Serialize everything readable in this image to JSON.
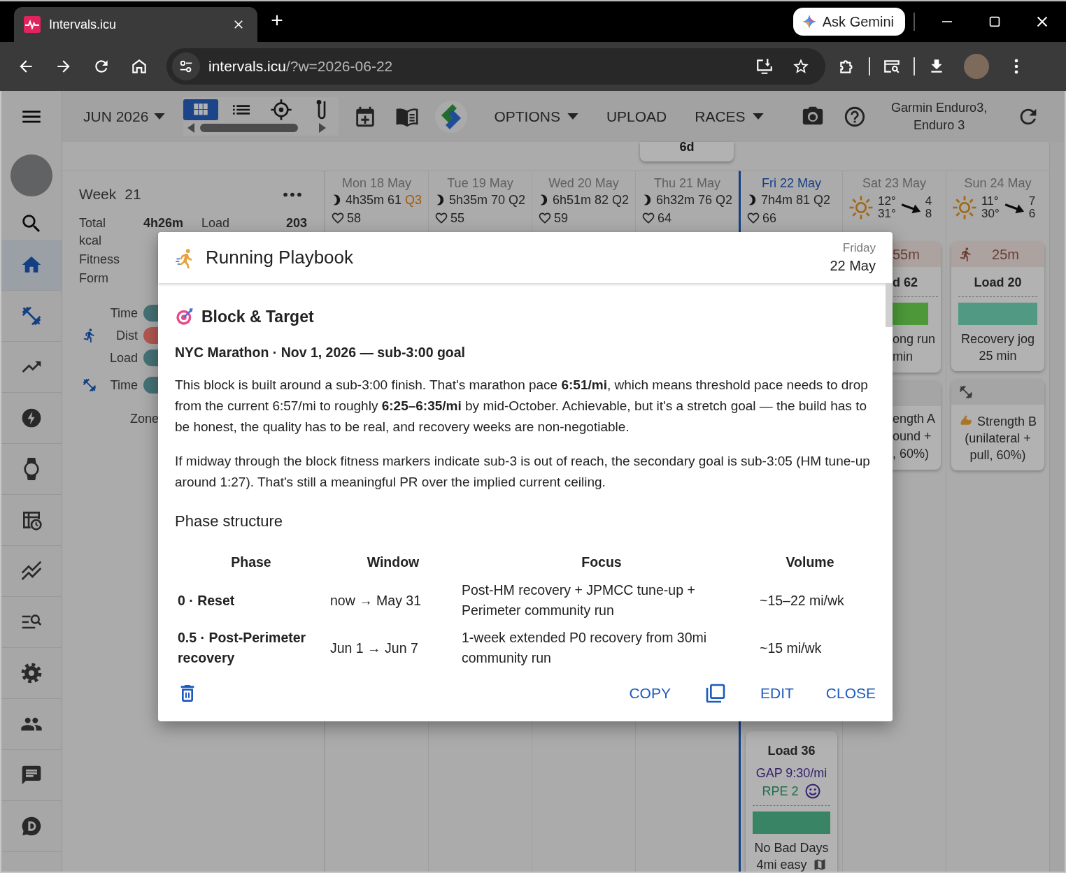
{
  "browser": {
    "tab_title": "Intervals.icu",
    "gemini_label": "Ask Gemini",
    "url_host": "intervals.icu",
    "url_path": "/?w=2026-06-22"
  },
  "nav": {
    "items": [
      {
        "kind": "home",
        "selected": true
      },
      {
        "kind": "dumbbell",
        "selected": false
      },
      {
        "kind": "trend",
        "selected": false
      },
      {
        "kind": "bolt",
        "selected": false
      },
      {
        "kind": "watch",
        "selected": false
      },
      {
        "kind": "calendar-clock",
        "selected": false
      },
      {
        "kind": "multiline",
        "selected": false
      },
      {
        "kind": "list-search",
        "selected": false
      },
      {
        "kind": "gear",
        "selected": false
      },
      {
        "kind": "people",
        "selected": false
      },
      {
        "kind": "chat",
        "selected": false
      },
      {
        "kind": "discord",
        "selected": false
      }
    ]
  },
  "toolbar": {
    "month": "JUN 2026",
    "views": [
      {
        "kind": "grid",
        "selected": true
      },
      {
        "kind": "list",
        "selected": false
      },
      {
        "kind": "target",
        "selected": false
      },
      {
        "kind": "pin",
        "selected": false
      }
    ],
    "menus": [
      {
        "label": "OPTIONS",
        "dropdown": true
      },
      {
        "label": "UPLOAD",
        "dropdown": false
      },
      {
        "label": "RACES",
        "dropdown": true
      }
    ],
    "device": "Garmin Enduro3, Enduro 3"
  },
  "calendar": {
    "pinned_tab": "6d",
    "week": {
      "label": "Week",
      "number": "21",
      "total": {
        "label": "Total",
        "value": "4h26m"
      },
      "load": {
        "label": "Load",
        "value": "203"
      },
      "metrics": [
        "kcal",
        "Fitness",
        "Form"
      ],
      "bars": [
        {
          "kind": "plain",
          "label": "Time",
          "color": "#457377"
        },
        {
          "kind": "run",
          "label": "Dist",
          "color": "#b25852"
        },
        {
          "kind": "plain",
          "label": "Load",
          "color": "#457377"
        },
        {
          "kind": "strength",
          "label": "Time",
          "color": "#457377"
        }
      ],
      "zones_label": "Zone"
    },
    "days": [
      {
        "date": "Mon 18 May",
        "today": false,
        "kind": "summary",
        "duration": "4h35m",
        "load": "61",
        "quality": "Q3",
        "quality_warning": true,
        "hr": "58"
      },
      {
        "date": "Tue 19 May",
        "today": false,
        "kind": "summary",
        "duration": "5h35m",
        "load": "70",
        "quality": "Q2",
        "quality_warning": false,
        "hr": "55"
      },
      {
        "date": "Wed 20 May",
        "today": false,
        "kind": "summary",
        "duration": "6h51m",
        "load": "82",
        "quality": "Q2",
        "quality_warning": false,
        "hr": "59"
      },
      {
        "date": "Thu 21 May",
        "today": false,
        "kind": "summary",
        "duration": "6h32m",
        "load": "76",
        "quality": "Q2",
        "quality_warning": false,
        "hr": "64"
      },
      {
        "date": "Fri 22 May",
        "today": true,
        "kind": "summary",
        "duration": "7h4m",
        "load": "81",
        "quality": "Q2",
        "quality_warning": false,
        "hr": "66",
        "cards": [
          {
            "kind": "run",
            "clipped_top": true,
            "clipped_left": false,
            "load": "Load 36",
            "pace": "GAP 9:30/mi",
            "rpe": "RPE 2",
            "color": "#3a8466",
            "text": "No Bad Days 4mi easy",
            "route": true
          }
        ]
      },
      {
        "date": "Sat 23 May",
        "today": false,
        "kind": "weather",
        "temp_1": "12°",
        "temp_2": "31°",
        "wind_1": "4",
        "wind_2": "8",
        "cards": [
          {
            "kind": "run",
            "clipped_top": false,
            "clipped_left": true,
            "duration": "55m",
            "load": "d 62",
            "color": "#4e9a3a",
            "lines": [
              "ong run",
              "min"
            ]
          },
          {
            "kind": "strength",
            "clipped_top": false,
            "clipped_left": true,
            "lines": [
              "ength A",
              "ound +",
              ", 60%)"
            ]
          }
        ]
      },
      {
        "date": "Sun 24 May",
        "today": false,
        "kind": "weather",
        "temp_1": "11°",
        "temp_2": "30°",
        "wind_1": "7",
        "wind_2": "6",
        "cards": [
          {
            "kind": "run",
            "clipped_top": false,
            "clipped_left": false,
            "duration": "25m",
            "load": "Load 20",
            "color": "#529a82",
            "text": "Recovery jog 25 min"
          },
          {
            "kind": "strength",
            "clipped_top": false,
            "clipped_left": false,
            "text": "Strength B (unilateral + pull, 60%)"
          }
        ]
      }
    ]
  },
  "dialog": {
    "title": "Running Playbook",
    "weekday": "Friday",
    "date": "22 May",
    "section": "Block & Target",
    "goal": "NYC Marathon · Nov 1, 2026 — sub-3:00 goal",
    "paragraphs": [
      "This block is built around a sub-3:00 finish. That's marathon pace **6:51/mi**, which means threshold pace needs to drop from the current 6:57/mi to roughly **6:25–6:35/mi** by mid-October. Achievable, but it's a stretch goal — the build has to be honest, the quality has to be real, and recovery weeks are non-negotiable.",
      "If midway through the block fitness markers indicate sub-3 is out of reach, the secondary goal is sub-3:05 (HM tune-up around 1:27). That's still a meaningful PR over the implied current ceiling."
    ],
    "subheading": "Phase structure",
    "table": {
      "columns": [
        "Phase",
        "Window",
        "Focus",
        "Volume"
      ],
      "rows": [
        [
          "0 · Reset",
          "now → May 31",
          "Post-HM recovery + JPMCC tune-up + Perimeter community run",
          "~15–22 mi/wk"
        ],
        [
          "0.5 · Post-Perimeter recovery",
          "Jun 1 → Jun 7",
          "1-week extended P0 recovery from 30mi community run",
          "~15 mi/wk"
        ]
      ]
    },
    "actions": [
      {
        "kind": "delete"
      },
      {
        "kind": "text",
        "label": "COPY"
      },
      {
        "kind": "duplicate"
      },
      {
        "kind": "text",
        "label": "EDIT"
      },
      {
        "kind": "text",
        "label": "CLOSE"
      }
    ]
  }
}
